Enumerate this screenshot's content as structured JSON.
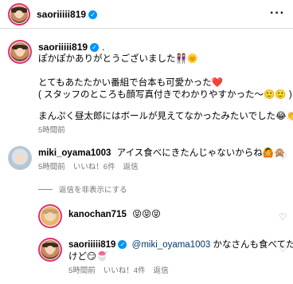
{
  "post": {
    "username": "saoriiiii819",
    "verified": true
  },
  "caption": {
    "username": "saoriiiii819",
    "suffix": ".",
    "lines": [
      "ぽかぽかありがとうございました👭🌞",
      "",
      "とてもあたたかい番組で台本も可愛かった❤️",
      "( スタッフのところも顔写真付きでわかりやすかった〜🙂🙂 )",
      "",
      "まんぷく昼太郎にはボールが見えてなかったみたいでした😂👏"
    ],
    "time": "5時間前"
  },
  "comments": [
    {
      "username": "miki_oyama1003",
      "text": "アイス食べにきたんじゃないからね🙆🙊",
      "time": "5時間前",
      "likes": "いいね！6件",
      "reply": "返信"
    }
  ],
  "hide_replies": "返信を非表示にする",
  "replies": [
    {
      "username": "kanochan715",
      "text": "😝😝😝"
    },
    {
      "username": "saoriiiii819",
      "verified": true,
      "mention": "@miki_oyama1003",
      "text_line1": " かなさんも食べてた",
      "text_line2": "けど😏🍧",
      "time": "5時間前",
      "likes": "いいね！4件",
      "reply": "返信"
    }
  ],
  "icons": {
    "more": "more-horizontal-icon",
    "verified": "verified-badge-icon",
    "like": "heart-icon"
  }
}
